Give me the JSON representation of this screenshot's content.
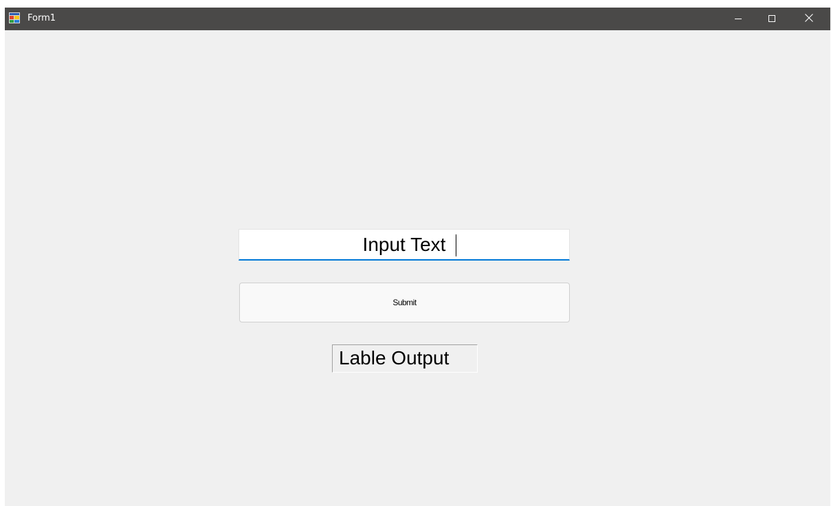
{
  "window": {
    "title": "Form1",
    "icon": "winforms-app-icon",
    "controls": {
      "minimize_icon": "minimize-icon",
      "maximize_icon": "maximize-icon",
      "close_icon": "close-icon"
    }
  },
  "form": {
    "input_value": "Input Text",
    "submit_label": "Submit",
    "output_label": "Lable Output"
  },
  "colors": {
    "titlebar": "#4a4948",
    "client_background": "#f0f0f0",
    "input_focus_underline": "#0078d7"
  }
}
